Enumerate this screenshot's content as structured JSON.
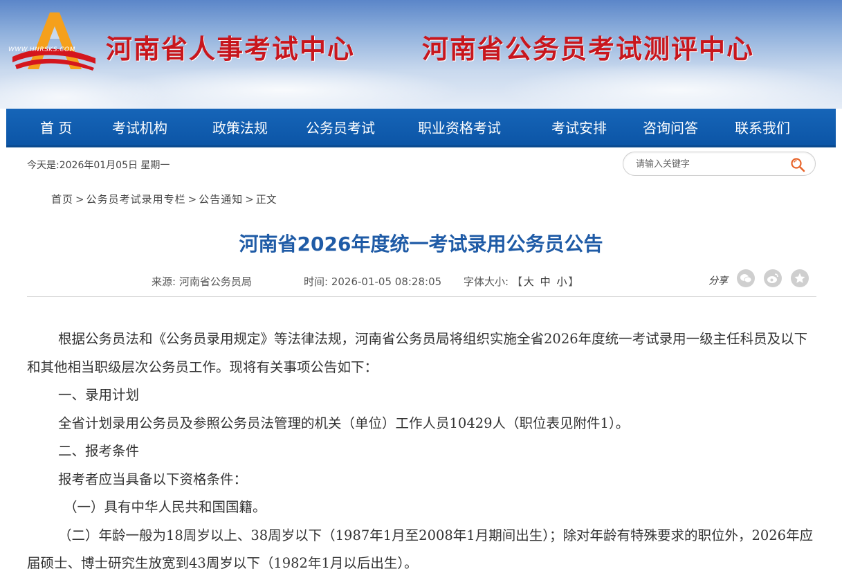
{
  "header": {
    "logo_url_text": "WWW.HNRSKS.COM",
    "title_left": "河南省人事考试中心",
    "title_right": "河南省公务员考试测评中心",
    "brand_color": "#c8161d"
  },
  "nav": {
    "items": [
      "首 页",
      "考试机构",
      "政策法规",
      "公务员考试",
      "职业资格考试",
      "考试安排",
      "咨询问答",
      "联系我们"
    ],
    "bg_color": "#0c55a6"
  },
  "today": "今天是:2026年01月05日 星期一",
  "search": {
    "placeholder": "请输入关键字",
    "icon": "search-icon"
  },
  "breadcrumb": [
    "首页",
    "公务员考试录用专栏",
    "公告通知",
    "正文"
  ],
  "breadcrumb_sep": ">",
  "article": {
    "title": "河南省2026年度统一考试录用公务员公告",
    "source_label": "来源:",
    "source_value": "河南省公务员局",
    "time_label": "时间:",
    "time_value": "2026-01-05 08:28:05",
    "fontsize_label": "字体大小:",
    "fontsize_open": "【",
    "fontsize_options": [
      "大",
      "中",
      "小"
    ],
    "fontsize_close": "】",
    "share_label": "分享",
    "share_icons": [
      "wechat-icon",
      "weibo-icon",
      "favorite-icon"
    ],
    "paragraphs": [
      "根据公务员法和《公务员录用规定》等法律法规，河南省公务员局将组织实施全省2026年度统一考试录用一级主任科员及以下和其他相当职级层次公务员工作。现将有关事项公告如下：",
      "一、录用计划",
      "全省计划录用公务员及参照公务员法管理的机关（单位）工作人员10429人（职位表见附件1）。",
      "二、报考条件",
      "报考者应当具备以下资格条件：",
      "（一）具有中华人民共和国国籍。",
      "（二）年龄一般为18周岁以上、38周岁以下（1987年1月至2008年1月期间出生）；除对年龄有特殊要求的职位外，2026年应届硕士、博士研究生放宽到43周岁以下（1982年1月以后出生）。"
    ],
    "title_color": "#1f5ba6"
  }
}
